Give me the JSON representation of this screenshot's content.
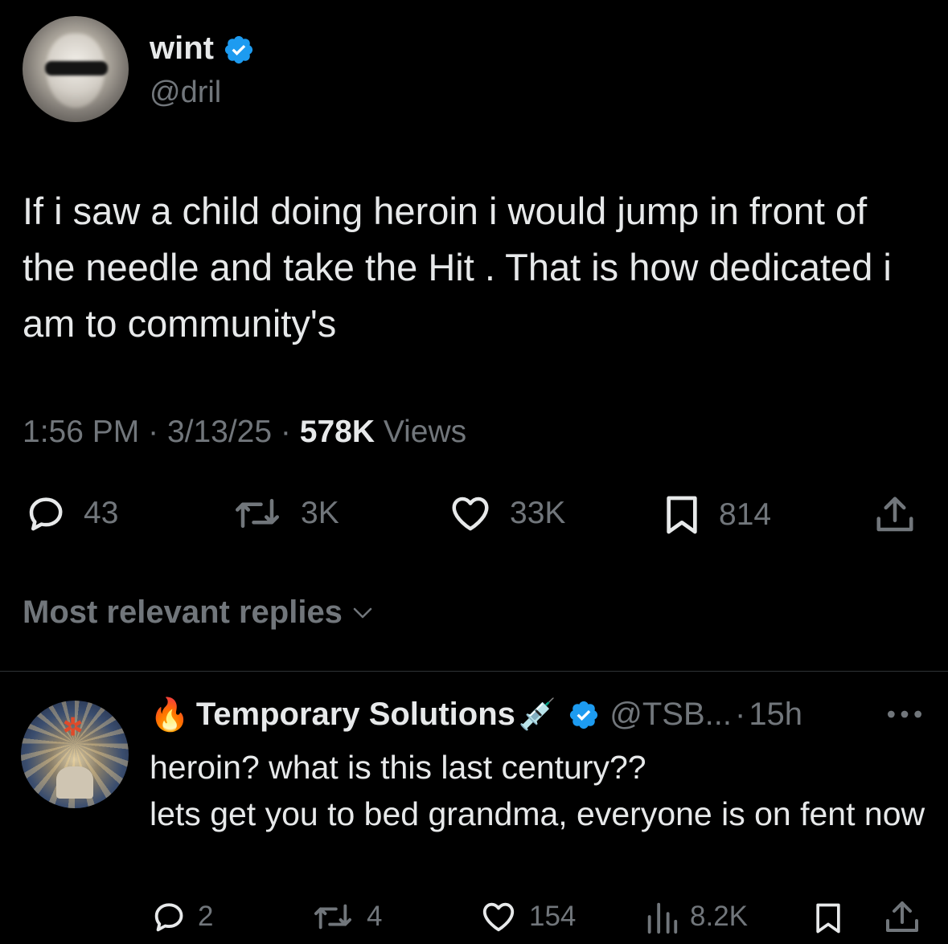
{
  "tweet": {
    "author_name": "wint",
    "author_handle": "@dril",
    "text": "If i saw a child doing heroin i would jump in front of the needle and take the Hit . That is how dedicated i am to community's",
    "time": "1:56 PM",
    "date": "3/13/25",
    "views_count": "578K",
    "views_label": "Views",
    "separator": "·",
    "stats": {
      "replies": "43",
      "retweets": "3K",
      "likes": "33K",
      "bookmarks": "814"
    }
  },
  "replies_sort": {
    "label": "Most relevant replies"
  },
  "reply": {
    "author_prefix_emoji": "🔥",
    "author_name": "Temporary Solutions",
    "author_suffix_emoji": "💉",
    "author_handle": "@TSB...",
    "separator": "·",
    "time_ago": "15h",
    "text_line1": "heroin? what is this last century??",
    "text_line2": "lets get you to bed grandma, everyone is on fent now",
    "stats": {
      "replies": "2",
      "retweets": "4",
      "likes": "154",
      "views": "8.2K"
    }
  },
  "colors": {
    "background": "#000000",
    "text_primary": "#e7e9ea",
    "text_secondary": "#71767b",
    "verified_blue": "#1d9bf0",
    "divider": "#2f3336"
  },
  "icons": [
    "verified-badge-icon",
    "reply-icon",
    "retweet-icon",
    "like-icon",
    "bookmark-icon",
    "share-icon",
    "chevron-down-icon",
    "more-icon",
    "views-icon"
  ]
}
